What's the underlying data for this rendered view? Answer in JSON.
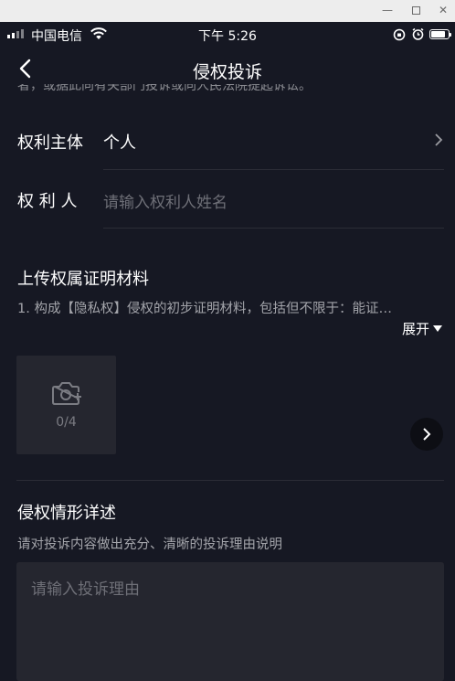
{
  "window": {
    "minimize_glyph": "—",
    "close_glyph": "✕"
  },
  "status_bar": {
    "carrier": "中国电信",
    "time": "下午 5:26",
    "battery_level": 0.85
  },
  "header": {
    "title": "侵权投诉"
  },
  "cut_off_text": "者，或据此向有关部门投诉或向人民法院提起诉讼。",
  "form": {
    "subject": {
      "label": "权利主体",
      "value": "个人"
    },
    "rights_holder": {
      "label": "权 利 人",
      "placeholder": "请输入权利人姓名"
    }
  },
  "upload": {
    "title": "上传权属证明材料",
    "description": "1. 构成【隐私权】侵权的初步证明材料，包括但不限于：能证…",
    "expand_label": "展开",
    "count": "0/4"
  },
  "details": {
    "title": "侵权情形详述",
    "description": "请对投诉内容做出充分、清晰的投诉理由说明",
    "placeholder": "请输入投诉理由"
  },
  "icons": [
    "back-arrow-icon",
    "chevron-right-icon",
    "camera-icon",
    "caret-down-icon",
    "wifi-icon",
    "lock-rotation-icon",
    "alarm-icon",
    "battery-icon"
  ]
}
